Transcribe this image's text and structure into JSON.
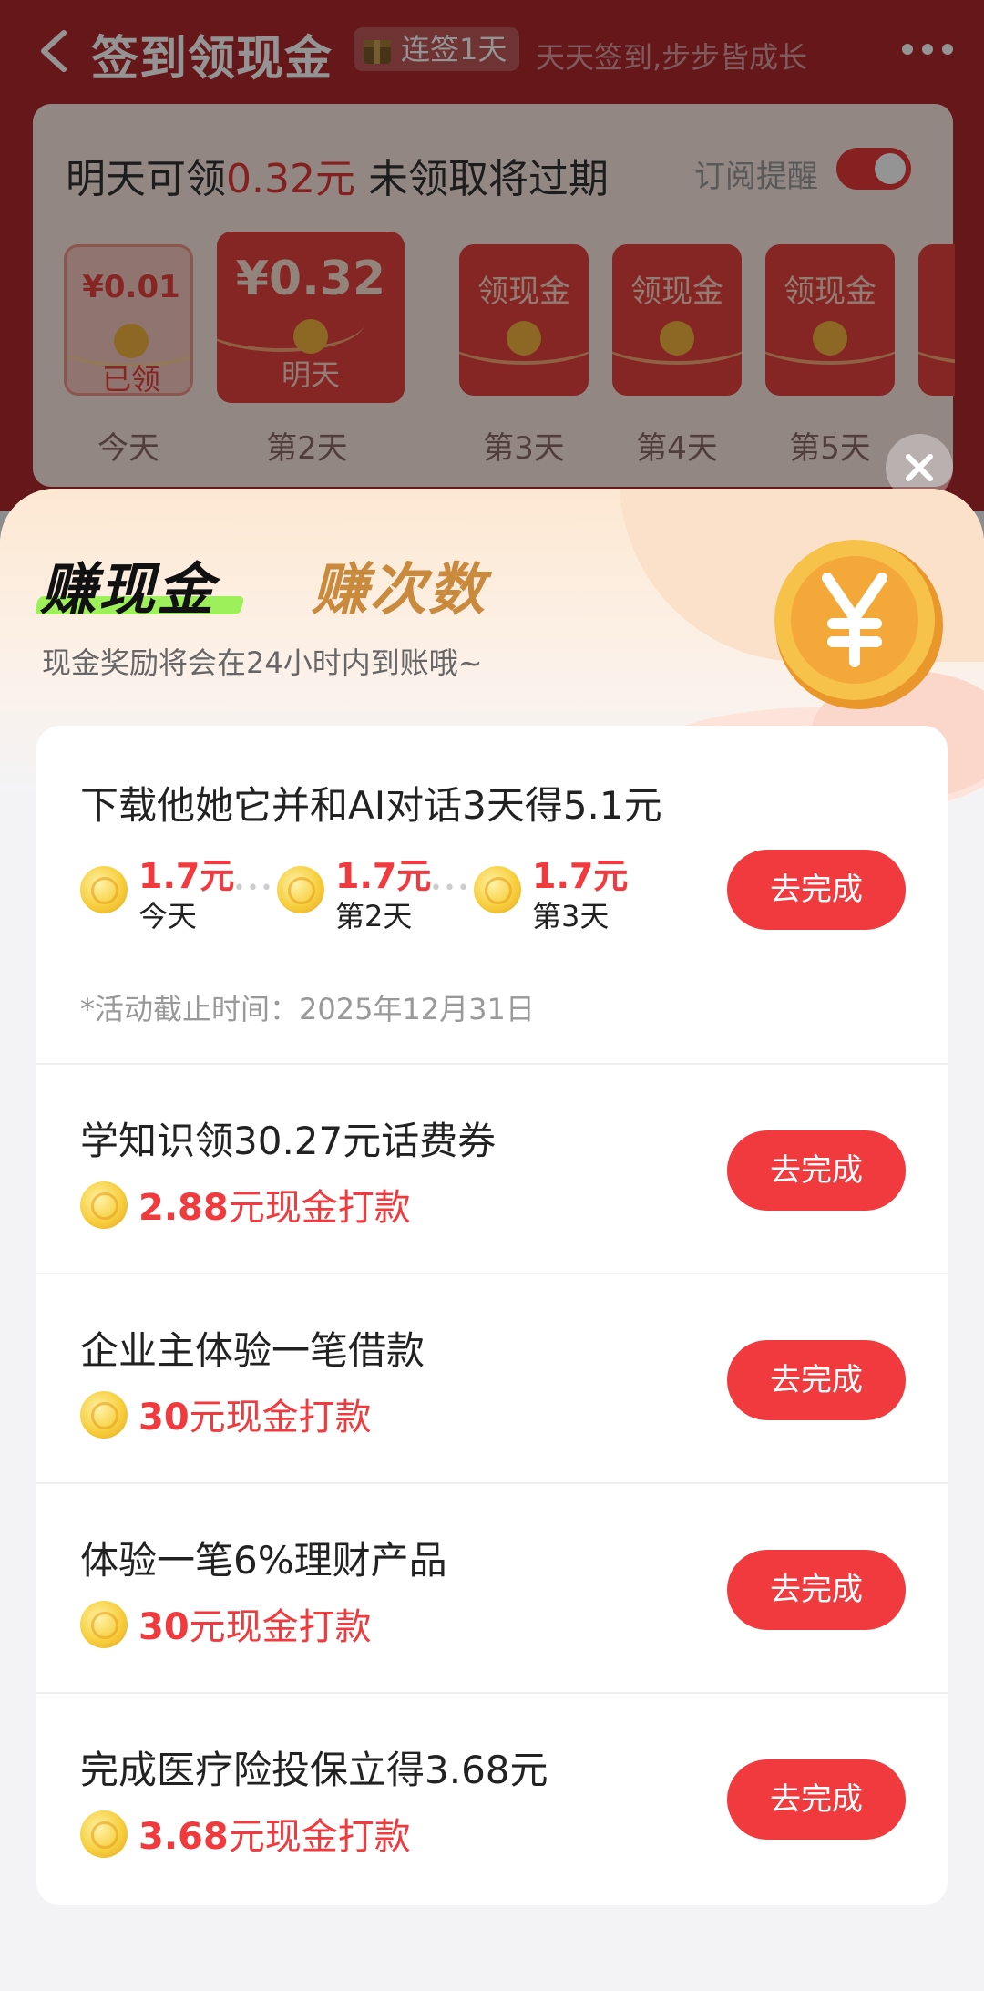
{
  "header": {
    "title": "签到领现金",
    "streak": "连签1天",
    "slogan": "天天签到,步步皆成长"
  },
  "checkin": {
    "headline_pre": "明天可领",
    "headline_amount": "0.32元",
    "headline_post": " 未领取将过期",
    "remind_label": "订阅提醒",
    "remind_on": true,
    "days": [
      {
        "top": "¥0.01",
        "bottom": "已领",
        "label": "今天"
      },
      {
        "top": "¥0.32",
        "bottom": "明天",
        "label": "第2天"
      },
      {
        "top": "领现金",
        "bottom": "",
        "label": "第3天"
      },
      {
        "top": "领现金",
        "bottom": "",
        "label": "第4天"
      },
      {
        "top": "领现金",
        "bottom": "",
        "label": "第5天"
      }
    ]
  },
  "sheet": {
    "tab_cash": "赚现金",
    "tab_count": "赚次数",
    "subtitle": "现金奖励将会在24小时内到账哦~",
    "tasks": [
      {
        "title": "下载他她它并和AI对话3天得5.1元",
        "steps": [
          {
            "amount": "1.7元",
            "day": "今天"
          },
          {
            "amount": "1.7元",
            "day": "第2天"
          },
          {
            "amount": "1.7元",
            "day": "第3天"
          }
        ],
        "deadline": "*活动截止时间：2025年12月31日",
        "button": "去完成"
      },
      {
        "title": "学知识领30.27元话费券",
        "reward_amount": "2.88",
        "reward_text": "元现金打款",
        "button": "去完成"
      },
      {
        "title": "企业主体验一笔借款",
        "reward_amount": "30",
        "reward_text": "元现金打款",
        "button": "去完成"
      },
      {
        "title": "体验一笔6%理财产品",
        "reward_amount": "30",
        "reward_text": "元现金打款",
        "button": "去完成"
      },
      {
        "title": "完成医疗险投保立得3.68元",
        "reward_amount": "3.68",
        "reward_text": "元现金打款",
        "button": "去完成"
      }
    ]
  },
  "colors": {
    "accent": "#f03a3e",
    "header_bg": "#b0292e",
    "tab_cash_underline": "#9ef05b",
    "tab_count": "#c98a3e"
  },
  "icons": [
    "back-arrow-icon",
    "gift-box-icon",
    "more-icon",
    "close-icon",
    "coin-icon",
    "yuan-coin-icon"
  ]
}
